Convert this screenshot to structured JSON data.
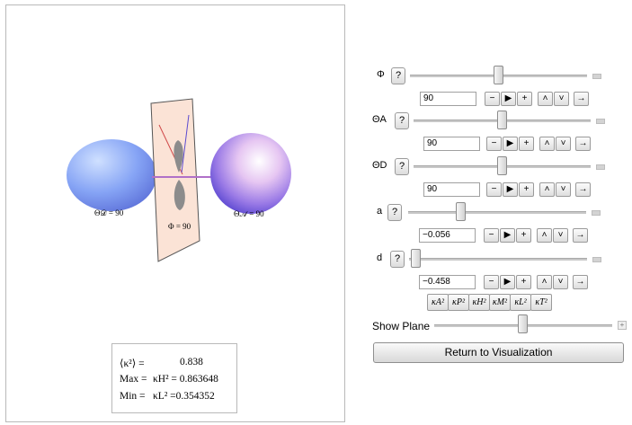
{
  "scene": {
    "label_d": "Θ𝒟 = 90",
    "label_phi": "Φ = 90",
    "label_a": "Θ𝒜 = 90"
  },
  "stats": {
    "kappa_label": "⟨κ²⟩ =",
    "kappa_value": "0.838",
    "max_label": "Max =",
    "max_value": "κH² = 0.863648",
    "min_label": "Min =",
    "min_value": "κL² =0.354352"
  },
  "controls": [
    {
      "label": "Φ",
      "value": "90",
      "level": 0.5
    },
    {
      "label": "ΘA",
      "value": "90",
      "level": 0.5
    },
    {
      "label": "ΘD",
      "value": "90",
      "level": 0.5
    },
    {
      "label": "a",
      "value": "−0.056",
      "level": 0.28
    },
    {
      "label": "d",
      "value": "−0.458",
      "level": 0.0
    }
  ],
  "help_label": "?",
  "animator_icons": [
    "minus-icon",
    "play-icon",
    "plus-icon",
    "faster-icon",
    "slower-icon",
    "direction-icon"
  ],
  "animator_glyphs": [
    "−",
    "▶",
    "+",
    "˄",
    "˅",
    "→"
  ],
  "kappa_buttons": [
    "κA²",
    "κP²",
    "κH²",
    "κM²",
    "κL²",
    "κT²"
  ],
  "show_plane": {
    "label": "Show Plane",
    "level": 0.5
  },
  "return_button": "Return to Visualization",
  "colors": {
    "plane": "#fbe3d6",
    "donor_lobe": "#7f9cf5",
    "acceptor_sphere": "#c9a2e8"
  }
}
